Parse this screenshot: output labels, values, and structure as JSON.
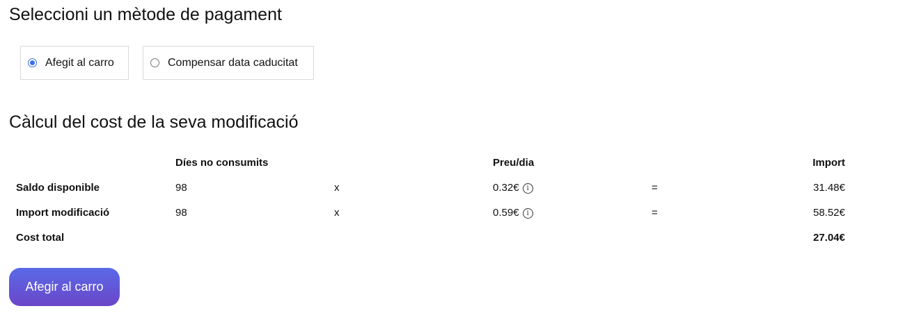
{
  "payment_section": {
    "title": "Seleccioni un mètode de pagament",
    "options": [
      {
        "label": "Afegit al carro",
        "selected": true
      },
      {
        "label": "Compensar data caducitat",
        "selected": false
      }
    ]
  },
  "cost_section": {
    "title": "Càlcul del cost de la seva modificació",
    "headers": {
      "days": "Díes no consumits",
      "price": "Preu/dia",
      "amount": "Import"
    },
    "rows": [
      {
        "label": "Saldo disponible",
        "days": "98",
        "times": "x",
        "price": "0.32€",
        "equals": "=",
        "amount": "31.48€"
      },
      {
        "label": "Import modificació",
        "days": "98",
        "times": "x",
        "price": "0.59€",
        "equals": "=",
        "amount": "58.52€"
      }
    ],
    "total": {
      "label": "Cost total",
      "amount": "27.04€"
    }
  },
  "cta": {
    "label": "Afegir al carro"
  },
  "colors": {
    "accent": "#3b6ee8",
    "button_top": "#5a6ae8",
    "button_bottom": "#6a46c8"
  },
  "icons": {
    "info": "info-icon"
  }
}
